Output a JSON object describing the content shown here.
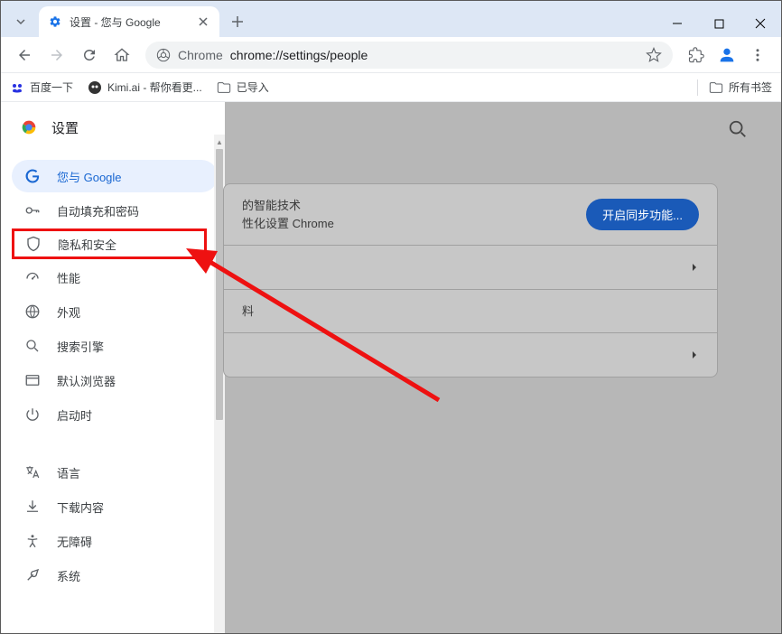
{
  "window": {
    "tab_title": "设置 - 您与 Google"
  },
  "toolbar": {
    "omnibox_prefix": "Chrome",
    "omnibox_url": "chrome://settings/people"
  },
  "bookmarks": {
    "items": [
      {
        "label": "百度一下"
      },
      {
        "label": "Kimi.ai - 帮你看更..."
      },
      {
        "label": "已导入"
      }
    ],
    "all_bookmarks": "所有书签"
  },
  "sidebar": {
    "title": "设置",
    "items": [
      {
        "label": "您与 Google"
      },
      {
        "label": "自动填充和密码"
      },
      {
        "label": "隐私和安全"
      },
      {
        "label": "性能"
      },
      {
        "label": "外观"
      },
      {
        "label": "搜索引擎"
      },
      {
        "label": "默认浏览器"
      },
      {
        "label": "启动时"
      }
    ],
    "items2": [
      {
        "label": "语言"
      },
      {
        "label": "下载内容"
      },
      {
        "label": "无障碍"
      },
      {
        "label": "系统"
      }
    ]
  },
  "main": {
    "sync_line1": "的智能技术",
    "sync_line2": "性化设置 Chrome",
    "sync_button": "开启同步功能...",
    "section2": "料"
  }
}
